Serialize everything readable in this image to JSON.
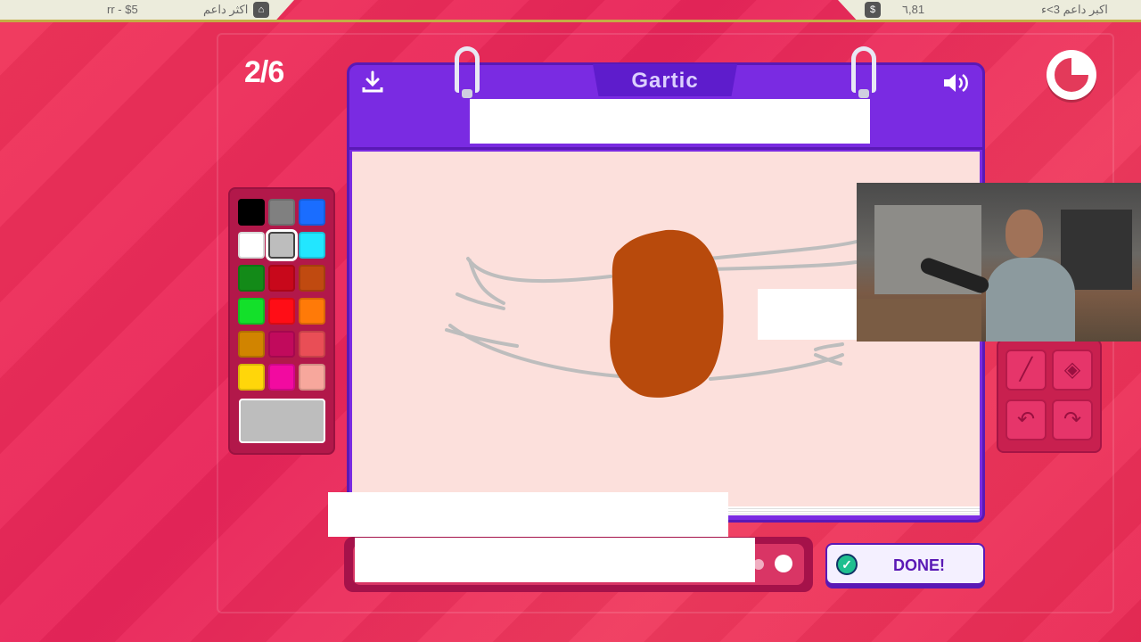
{
  "topbar": {
    "left_amount": "rr - $5",
    "left_name": "اكثر داعم",
    "right_amount": "٦,81",
    "right_name": "اكبر داعم 3>ء"
  },
  "game": {
    "round_counter": "2/6",
    "logo": "Gartic",
    "done_label": "DONE!",
    "timer_remaining_fraction": 0.25
  },
  "palette": {
    "colors": [
      "#000000",
      "#808080",
      "#1a6dff",
      "#ffffff",
      "#bdbdbd",
      "#22e6ff",
      "#138a18",
      "#c8081b",
      "#c04a10",
      "#13e02a",
      "#ff0d16",
      "#ff7a08",
      "#d18400",
      "#c10a5c",
      "#e94e56",
      "#ffd60a",
      "#f20aa0",
      "#f7a79c"
    ],
    "selected_index": 4,
    "current_color": "#bdbdbd"
  },
  "tools": [
    "line-icon",
    "fill-bucket-icon",
    "undo-icon",
    "redo-icon"
  ],
  "icons": {
    "download": "download-icon",
    "sound": "speaker-icon",
    "timer": "timer-icon",
    "coin": "coin-bag-icon",
    "home": "home-icon",
    "done": "check-icon"
  }
}
